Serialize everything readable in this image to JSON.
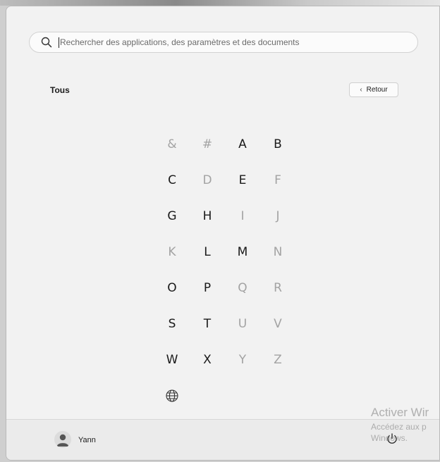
{
  "search": {
    "placeholder": "Rechercher des applications, des paramètres et des documents"
  },
  "all_apps": {
    "title": "Tous",
    "back_label": "Retour"
  },
  "letters": [
    {
      "label": "&",
      "enabled": false
    },
    {
      "label": "#",
      "enabled": false
    },
    {
      "label": "A",
      "enabled": true
    },
    {
      "label": "B",
      "enabled": true
    },
    {
      "label": "C",
      "enabled": true
    },
    {
      "label": "D",
      "enabled": false
    },
    {
      "label": "E",
      "enabled": true
    },
    {
      "label": "F",
      "enabled": false
    },
    {
      "label": "G",
      "enabled": true
    },
    {
      "label": "H",
      "enabled": true
    },
    {
      "label": "I",
      "enabled": false
    },
    {
      "label": "J",
      "enabled": false
    },
    {
      "label": "K",
      "enabled": false
    },
    {
      "label": "L",
      "enabled": true
    },
    {
      "label": "M",
      "enabled": true
    },
    {
      "label": "N",
      "enabled": false
    },
    {
      "label": "O",
      "enabled": true
    },
    {
      "label": "P",
      "enabled": true
    },
    {
      "label": "Q",
      "enabled": false
    },
    {
      "label": "R",
      "enabled": false
    },
    {
      "label": "S",
      "enabled": true
    },
    {
      "label": "T",
      "enabled": true
    },
    {
      "label": "U",
      "enabled": false
    },
    {
      "label": "V",
      "enabled": false
    },
    {
      "label": "W",
      "enabled": true
    },
    {
      "label": "X",
      "enabled": true
    },
    {
      "label": "Y",
      "enabled": false
    },
    {
      "label": "Z",
      "enabled": false
    }
  ],
  "globe_item": {
    "icon": "globe-icon",
    "enabled": true
  },
  "footer": {
    "user_name": "Yann",
    "power_icon": "power-icon"
  },
  "watermark": {
    "line1": "Activer Wir",
    "line2": "Accédez aux p",
    "line3": "Windows."
  }
}
